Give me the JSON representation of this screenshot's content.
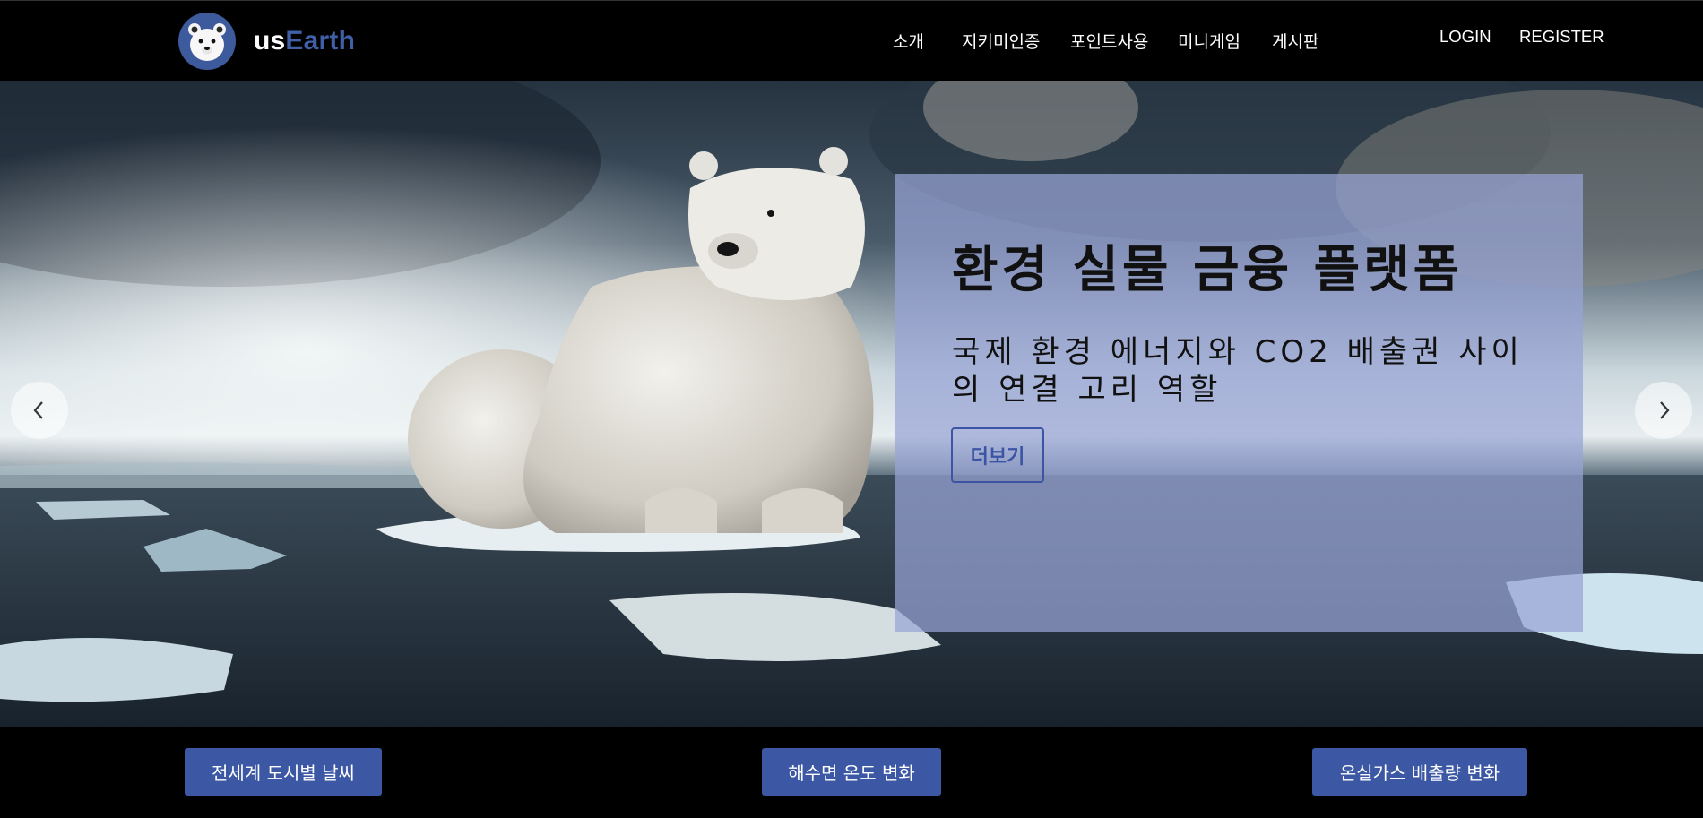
{
  "brand": {
    "name_part1": "us",
    "name_part2": "Earth",
    "logo_icon": "polar-bear-icon",
    "colors": {
      "primary": "#3f5fa6",
      "button": "#3c58a4"
    }
  },
  "nav": {
    "items": [
      {
        "label": "소개"
      },
      {
        "label": "지키미인증"
      },
      {
        "label": "포인트사용"
      },
      {
        "label": "미니게임"
      },
      {
        "label": "게시판"
      }
    ]
  },
  "auth": {
    "login": "LOGIN",
    "register": "REGISTER"
  },
  "hero": {
    "title": "환경 실물 금융 플랫폼",
    "subtitle": "국제 환경 에너지와 CO2 배출권 사이의 연결 고리 역할",
    "more_button": "더보기",
    "prev_icon": "chevron-left-icon",
    "next_icon": "chevron-right-icon"
  },
  "footer_buttons": [
    {
      "label": "전세계 도시별 날씨"
    },
    {
      "label": "해수면 온도 변화"
    },
    {
      "label": "온실가스 배출량 변화"
    }
  ]
}
